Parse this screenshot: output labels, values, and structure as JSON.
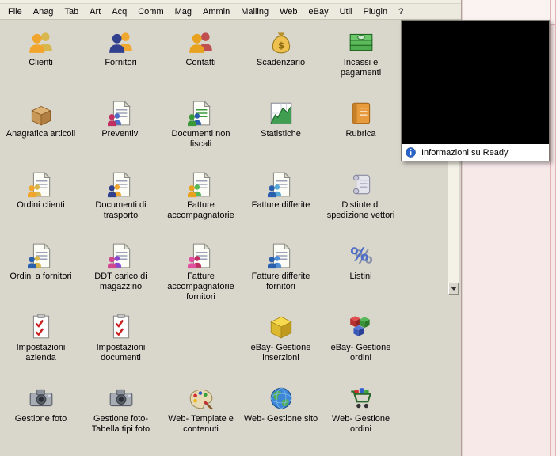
{
  "menu_bar": {
    "items": [
      "File",
      "Anag",
      "Tab",
      "Art",
      "Acq",
      "Comm",
      "Mag",
      "Ammin",
      "Mailing",
      "Web",
      "eBay",
      "Util",
      "Plugin",
      "?"
    ]
  },
  "help_menu": {
    "items": [
      {
        "label": "Informazioni su Ready",
        "icon": "info-icon"
      }
    ]
  },
  "grid": {
    "items": [
      {
        "label": "Clienti",
        "icon": "clients-icon"
      },
      {
        "label": "Fornitori",
        "icon": "suppliers-icon"
      },
      {
        "label": "Contatti",
        "icon": "contacts-icon"
      },
      {
        "label": "Scadenzario",
        "icon": "money-bag-icon"
      },
      {
        "label": "Incassi e pagamenti",
        "icon": "cash-stack-icon"
      },
      {
        "label": "Anagrafica articoli",
        "icon": "box-icon"
      },
      {
        "label": "Preventivi",
        "icon": "document-people-icon"
      },
      {
        "label": "Documenti non fiscali",
        "icon": "document-people-icon"
      },
      {
        "label": "Statistiche",
        "icon": "chart-icon"
      },
      {
        "label": "Rubrica",
        "icon": "address-book-icon"
      },
      {
        "label": "Ordini clienti",
        "icon": "document-people-icon"
      },
      {
        "label": "Documenti di trasporto",
        "icon": "document-people-icon"
      },
      {
        "label": "Fatture accompagnatorie",
        "icon": "document-people-icon"
      },
      {
        "label": "Fatture differite",
        "icon": "document-people-icon"
      },
      {
        "label": "Distinte di spedizione vettori",
        "icon": "scroll-icon"
      },
      {
        "label": "Ordini a fornitori",
        "icon": "document-people-icon"
      },
      {
        "label": "DDT carico di magazzino",
        "icon": "document-people-icon"
      },
      {
        "label": "Fatture accompagnatorie fornitori",
        "icon": "document-people-icon"
      },
      {
        "label": "Fatture differite fornitori",
        "icon": "document-people-icon"
      },
      {
        "label": "Listini",
        "icon": "percent-icon"
      },
      {
        "label": "Impostazioni azienda",
        "icon": "checklist-icon"
      },
      {
        "label": "Impostazioni documenti",
        "icon": "checklist-icon"
      },
      {
        "label": "eBay- Gestione inserzioni",
        "icon": "cube-icon"
      },
      {
        "label": "eBay- Gestione ordini",
        "icon": "cubes-icon"
      },
      {
        "label": "Gestione foto",
        "icon": "camera-icon"
      },
      {
        "label": "Gestione foto- Tabella tipi foto",
        "icon": "camera-icon"
      },
      {
        "label": "Web- Template e contenuti",
        "icon": "palette-icon"
      },
      {
        "label": "Web- Gestione sito",
        "icon": "globe-icon"
      },
      {
        "label": "Web- Gestione ordini",
        "icon": "cart-icon"
      }
    ]
  },
  "colors": {
    "panel_bg": "#d9d6cc",
    "menubar_bg": "#eceadf",
    "side_bg": "#f8e9e9",
    "side_line": "#e0b4b4",
    "info_blue": "#2a63c8"
  }
}
